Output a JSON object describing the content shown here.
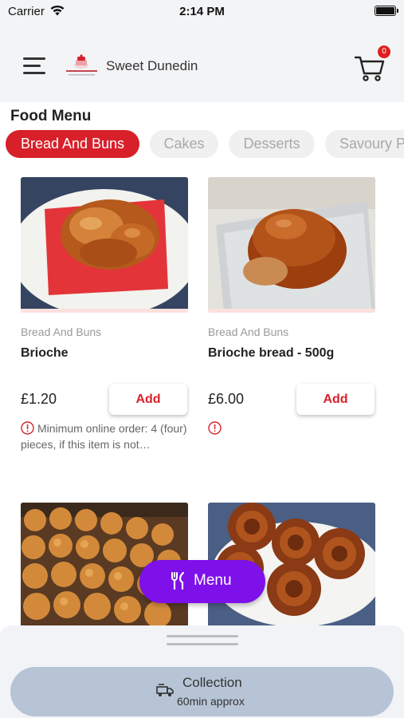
{
  "status_bar": {
    "carrier": "Carrier",
    "time": "2:14 PM",
    "icons": [
      "wifi-icon",
      "battery-icon"
    ]
  },
  "header": {
    "menu_icon": "hamburger-menu-icon",
    "brand_name": "Sweet Dunedin",
    "cart_count": "0"
  },
  "menu": {
    "title": "Food Menu",
    "categories": [
      {
        "label": "Bread And Buns",
        "active": true
      },
      {
        "label": "Cakes",
        "active": false
      },
      {
        "label": "Desserts",
        "active": false
      },
      {
        "label": "Savoury Pies",
        "active": false
      }
    ]
  },
  "products": [
    {
      "category": "Bread And Buns",
      "name": "Brioche",
      "price": "£1.20",
      "add_label": "Add",
      "note": "Minimum online order: 4 (four) pieces, if this item is not…"
    },
    {
      "category": "Bread And Buns",
      "name": "Brioche bread - 500g",
      "price": "£6.00",
      "add_label": "Add",
      "note": ""
    }
  ],
  "fab": {
    "label": "Menu",
    "icon": "fork-knife-icon"
  },
  "bottom_sheet": {
    "collection_title": "Collection",
    "collection_subtitle": "60min approx",
    "icon": "delivery-van-icon"
  },
  "colors": {
    "accent_red": "#d8202a",
    "fab_purple": "#7e10ea",
    "header_bg": "#f3f4f6",
    "collection_bg": "#b7c4d6"
  }
}
